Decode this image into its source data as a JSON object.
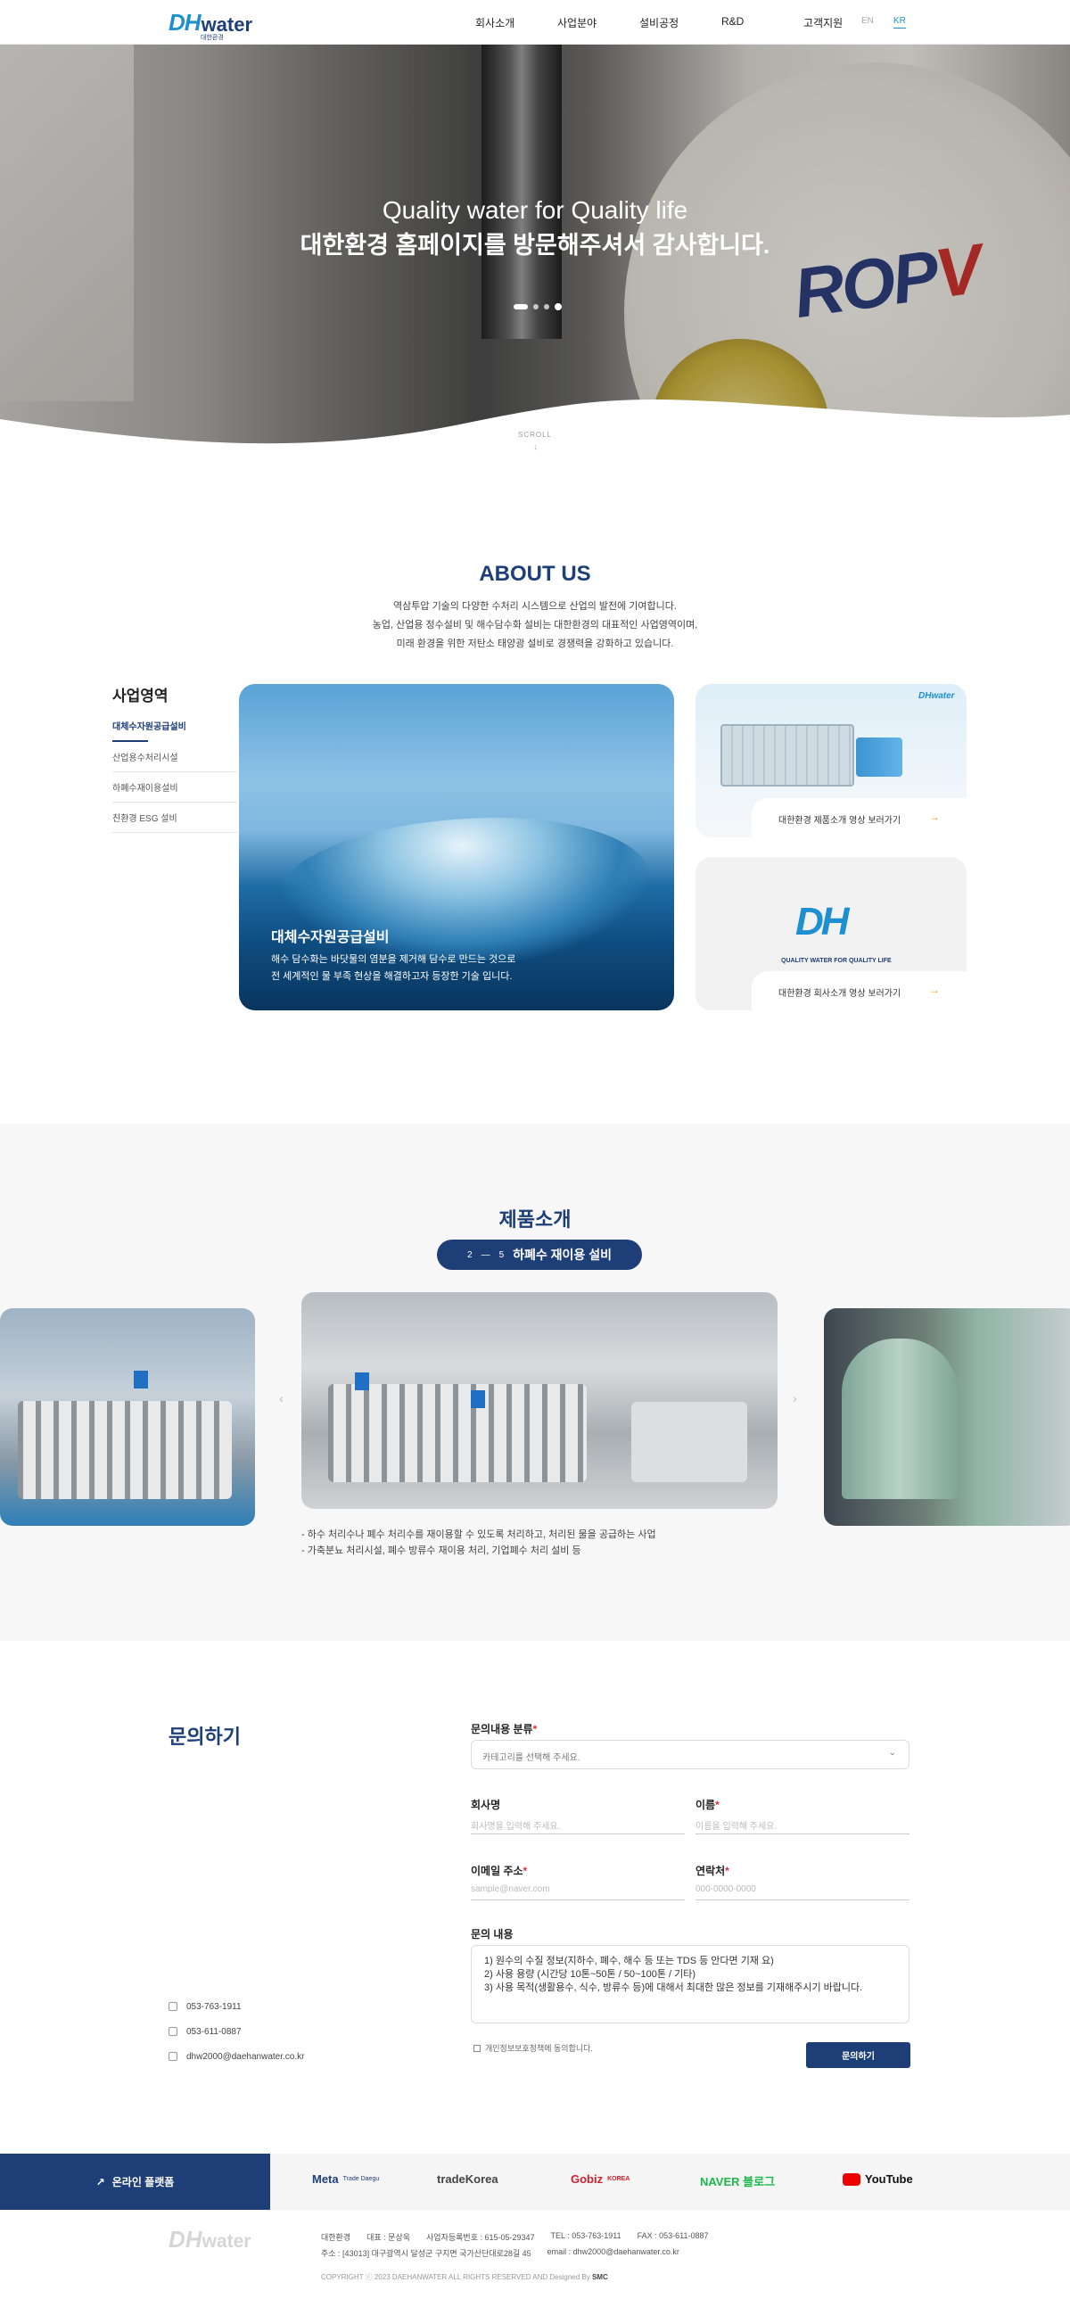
{
  "header": {
    "logo_mark": "DH",
    "logo_text": "water",
    "logo_sub": "대한환경",
    "nav": [
      "회사소개",
      "사업분야",
      "설비공정",
      "R&D",
      "고객지원"
    ],
    "lang_en": "EN",
    "lang_kr": "KR"
  },
  "hero": {
    "title": "Quality water for Quality life",
    "subtitle": "대한환경 홈페이지를 방문해주셔서 감사합니다.",
    "scroll": "SCROLL",
    "roll_logo_a": "ROP",
    "roll_logo_b": "V"
  },
  "about": {
    "title": "ABOUT US",
    "desc": [
      "역삼투압 기술의 다양한 수처리 시스템으로 산업의 발전에 기여합니다.",
      "농업, 산업용 정수설비 및 해수담수화 설비는 대한환경의 대표적인 사업영역이며,",
      "미래 환경을 위한 저탄소 태양광 설비로 경쟁력을 강화하고 있습니다."
    ],
    "biz_title": "사업영역",
    "biz_menu": [
      "대체수자원공급설비",
      "산업용수처리시설",
      "하폐수재이용설비",
      "친환경 ESG 설비"
    ],
    "card_title": "대체수자원공급설비",
    "card_desc": [
      "해수 담수화는 바닷물의 염분을 제거해 담수로 만드는 것으로",
      "전 세계적인 물 부족 현상을 해결하고자 등장한 기술 입니다."
    ],
    "side1_btn": "대한환경 제품소개 영상 보러가기",
    "side2_btn": "대한환경 회사소개 영상 보러가기",
    "side_arrow": "→",
    "dh_logo": "DH",
    "dh_tag": "QUALITY WATER FOR QUALITY LIFE",
    "mini_logo": "DHwater"
  },
  "products": {
    "title": "제품소개",
    "pill_index": "2",
    "pill_divider": "—",
    "pill_total": "5",
    "pill_label": "하폐수 재이용 설비",
    "prev": "‹",
    "next": "›",
    "bullets": [
      "- 하수 처리수나 폐수 처리수를 재이용할 수 있도록 처리하고, 처리된 물을 공급하는 사업",
      "- 가축분뇨 처리시설, 폐수 방류수 재이용 처리, 기업폐수 처리 설비 등"
    ]
  },
  "contact": {
    "title": "문의하기",
    "phone": "053-763-1911",
    "fax": "053-611-0887",
    "email": "dhw2000@daehanwater.co.kr",
    "category_label": "문의내용 분류",
    "category_placeholder": "카테고리를 선택해 주세요.",
    "company_label": "회사명",
    "company_placeholder": "회사명을 입력해 주세요.",
    "name_label": "이름",
    "name_placeholder": "이름을 입력해 주세요.",
    "email_label": "이메일 주소",
    "email_placeholder": "sample@naver.com",
    "tel_label": "연락처",
    "tel_placeholder": "000-0000-0000",
    "content_label": "문의 내용",
    "content_lines": [
      "1) 원수의 수질 정보(지하수, 폐수, 해수 등 또는 TDS 등 안다면 기재 요)",
      "2) 사용 용량 (시간당 10톤~50톤 / 50~100톤 / 기타)",
      "3) 사용 목적(생활용수, 식수, 방류수 등)에 대해서 최대한 많은 정보를 기재해주시기 바랍니다."
    ],
    "required_mark": "*",
    "agree": "개인정보보호정책에 동의합니다.",
    "submit": "문의하기",
    "chevron": "⌄"
  },
  "platforms": {
    "button": "온라인 플랫폼",
    "items": [
      {
        "name": "Meta",
        "sub": "Trade Daegu",
        "color": "#1e3e78"
      },
      {
        "name": "tradeKorea",
        "color": "#444444"
      },
      {
        "name": "Gobiz",
        "sub": "KOREA",
        "color": "#d3212c"
      },
      {
        "name": "NAVER 블로그",
        "color": "#19b94a"
      },
      {
        "name": "YouTube",
        "color": "#111111"
      }
    ]
  },
  "footer": {
    "logo_mark": "DH",
    "logo_text": "water",
    "line1": [
      "대한환경",
      "대표 : 문상욱",
      "사업자등록번호 : 615-05-29347",
      "TEL : 053-763-1911",
      "FAX : 053-611-0887"
    ],
    "line2": [
      "주소 : [43013] 대구광역시 달성군 구지면 국가산단대로28길 45",
      "email : dhw2000@daehanwater.co.kr"
    ],
    "copyright": "COPYRIGHT ⓒ 2023 DAEHANWATER ALL RIGHTS RESERVED AND Designed By",
    "designer": "SMC"
  },
  "colors": {
    "navy": "#1e3e78",
    "sky": "#1e8fd1",
    "accent": "#e7a21a"
  }
}
